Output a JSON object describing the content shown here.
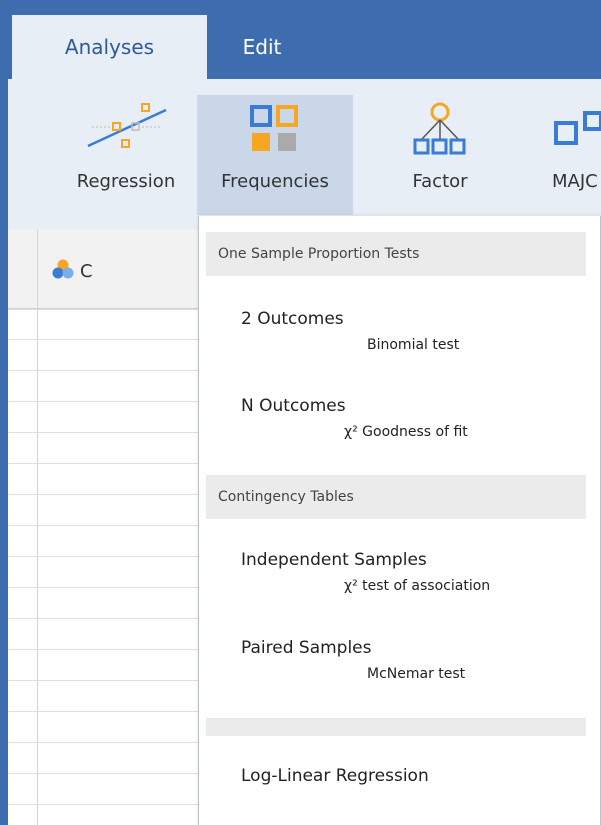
{
  "tabs": [
    {
      "label": "Analyses",
      "active": true
    },
    {
      "label": "Edit",
      "active": false
    }
  ],
  "ribbon": {
    "buttons": [
      {
        "label": "Regression",
        "icon": "regression-icon"
      },
      {
        "label": "Frequencies",
        "icon": "frequencies-icon",
        "selected": true
      },
      {
        "label": "Factor",
        "icon": "factor-icon"
      },
      {
        "label": "MAJC",
        "icon": "majc-icon"
      }
    ]
  },
  "sheet": {
    "column": {
      "name": "C",
      "icon": "nominal-variable-icon"
    }
  },
  "menu": {
    "groups": [
      {
        "header": "One Sample Proportion Tests",
        "items": [
          {
            "title": "2 Outcomes",
            "subtitle": "Binomial test"
          },
          {
            "title": "N Outcomes",
            "subtitle": "χ² Goodness of fit"
          }
        ]
      },
      {
        "header": "Contingency Tables",
        "items": [
          {
            "title": "Independent Samples",
            "subtitle": "χ² test of association"
          },
          {
            "title": "Paired Samples",
            "subtitle": "McNemar test"
          }
        ]
      }
    ],
    "extra_item": "Log-Linear Regression"
  },
  "colors": {
    "header_blue": "#3e6daf",
    "ribbon_bg": "#e8eef6",
    "selected_bg": "#c9d7e8",
    "icon_orange": "#f5a623",
    "icon_blue": "#3a7bd5"
  }
}
